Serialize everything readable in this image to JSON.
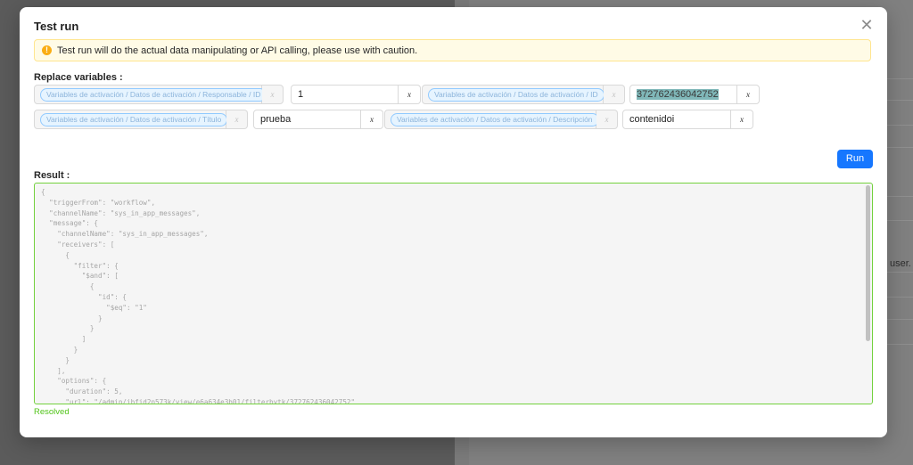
{
  "background": {
    "partial_text": "user."
  },
  "modal": {
    "title": "Test run",
    "alert": "Test run will do the actual data manipulating or API calling, please use with caution.",
    "replace_label": "Replace variables :",
    "variables": [
      {
        "label": "Variables de activación / Datos de activación / Responsable / ID",
        "value": "1"
      },
      {
        "label": "Variables de activación / Datos de activación / ID",
        "value": "372762436042752"
      },
      {
        "label": "Variables de activación / Datos de activación / Título",
        "value": "prueba"
      },
      {
        "label": "Variables de activación / Datos de activación / Descripción",
        "value": "contenidoi"
      }
    ],
    "x_label": "x",
    "run_label": "Run",
    "result_label": "Result :",
    "result_code": "{\n  \"triggerFrom\": \"workflow\",\n  \"channelName\": \"sys_in_app_messages\",\n  \"message\": {\n    \"channelName\": \"sys_in_app_messages\",\n    \"receivers\": [\n      {\n        \"filter\": {\n          \"$and\": [\n            {\n              \"id\": {\n                \"$eq\": \"1\"\n              }\n            }\n          ]\n        }\n      }\n    ],\n    \"options\": {\n      \"duration\": 5,\n      \"url\": \"/admin/ibfid2n573k/view/e6a634e3b01/filterbytk/372762436042752\"",
    "status": "Resolved"
  },
  "colors": {
    "primary": "#1677ff",
    "success": "#52c41a",
    "warning": "#faad14"
  }
}
